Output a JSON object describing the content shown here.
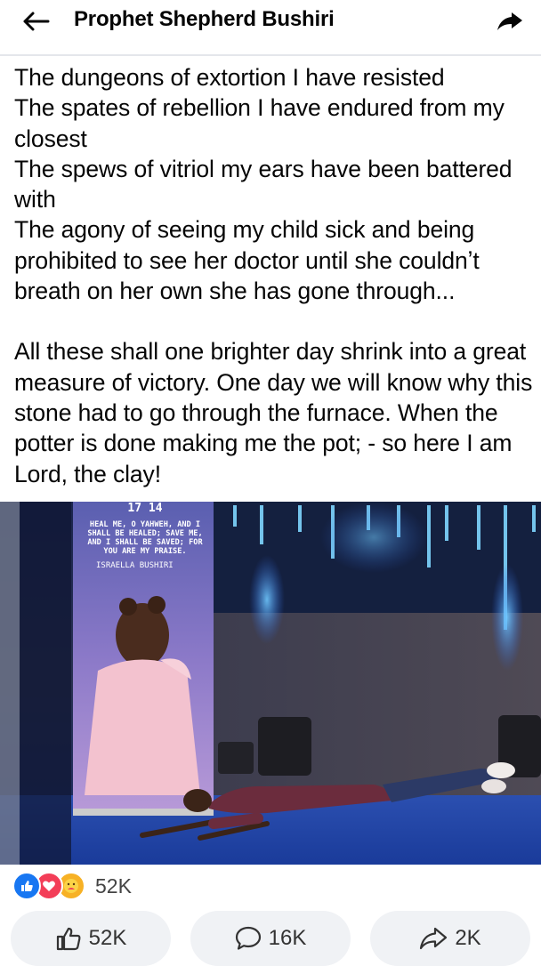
{
  "header": {
    "title": "Prophet Shepherd Bushiri",
    "back_icon": "arrow-left-icon",
    "share_icon": "share-arrow-icon"
  },
  "post": {
    "paragraph1": [
      "The dungeons of extortion I have resisted",
      "The spates of rebellion I have endured from my closest",
      "The spews of vitriol my ears have been battered with",
      "The agony of seeing my child sick and being prohibited to see her doctor until she couldnʼt breath on her own she has gone through..."
    ],
    "paragraph2": "All these shall one brighter day shrink into a great measure of victory. One day we will know why this stone had to go through the furnace. When the potter is done making me the pot; - so here I am Lord, the clay!"
  },
  "photo": {
    "banner_top": "17 14",
    "banner_text": [
      "HEAL ME, O YAHWEH, AND I",
      "SHALL BE HEALED; SAVE ME,",
      "AND I SHALL BE SAVED; FOR",
      "YOU ARE MY PRAISE."
    ],
    "banner_signature": "ISRAELLA BUSHIRI"
  },
  "reactions": {
    "icons": [
      "like-icon",
      "love-icon",
      "care-icon"
    ],
    "count": "52K"
  },
  "actions": {
    "like": {
      "label": "52K",
      "icon": "thumbs-up-icon"
    },
    "comment": {
      "label": "16K",
      "icon": "comment-icon"
    },
    "share": {
      "label": "2K",
      "icon": "share-icon"
    }
  },
  "colors": {
    "like_blue": "#1877f2",
    "love_red": "#f33e58",
    "care_yellow": "#f7b125",
    "button_bg": "#f0f2f5"
  }
}
